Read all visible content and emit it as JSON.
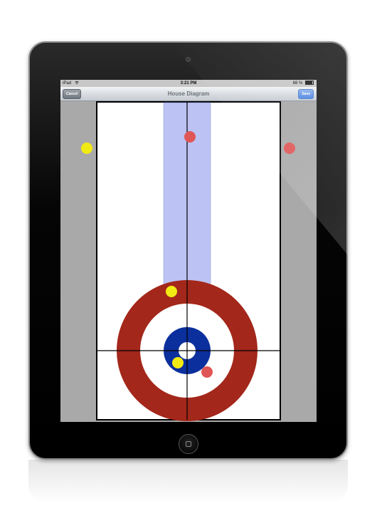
{
  "status_bar": {
    "carrier": "iPad",
    "time": "3:21 PM",
    "battery": "88 %"
  },
  "nav_bar": {
    "title": "House Diagram",
    "cancel_label": "Cancel",
    "save_label": "Save"
  },
  "colors": {
    "outer_ring": "#a3271a",
    "button_ring": "#0b2f9c",
    "lane": "#bcc2f3",
    "yellow_stone": "#f2ea14",
    "red_stone": "#e05555",
    "gutter": "#a9a9a9"
  },
  "stones": [
    {
      "team": "yellow",
      "location": "off-sheet left"
    },
    {
      "team": "red",
      "location": "off-sheet right"
    },
    {
      "team": "red",
      "location": "center line, top"
    },
    {
      "team": "yellow",
      "location": "top of house"
    },
    {
      "team": "yellow",
      "location": "near button"
    },
    {
      "team": "red",
      "location": "near button"
    }
  ]
}
